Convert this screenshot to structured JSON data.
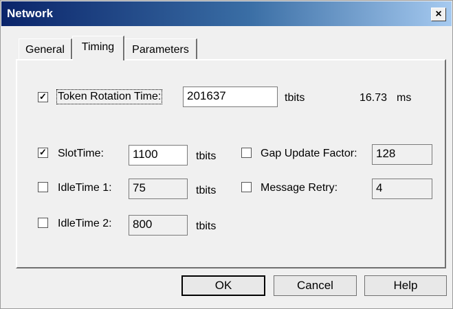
{
  "window": {
    "title": "Network",
    "close_glyph": "×"
  },
  "tabs": [
    {
      "label": "General",
      "active": false
    },
    {
      "label": "Timing",
      "active": true
    },
    {
      "label": "Parameters",
      "active": false
    }
  ],
  "token_rotation": {
    "label": "Token Rotation Time:",
    "checked": true,
    "value": "201637",
    "unit": "tbits",
    "ms_value": "16.73",
    "ms_unit": "ms"
  },
  "slot_time": {
    "label": "SlotTime:",
    "checked": true,
    "value": "1100",
    "unit": "tbits"
  },
  "idle_time_1": {
    "label": "IdleTime 1:",
    "checked": false,
    "value": "75",
    "unit": "tbits"
  },
  "idle_time_2": {
    "label": "IdleTime 2:",
    "checked": false,
    "value": "800",
    "unit": "tbits"
  },
  "gap_update": {
    "label": "Gap Update Factor:",
    "checked": false,
    "value": "128"
  },
  "message_retry": {
    "label": "Message Retry:",
    "checked": false,
    "value": "4"
  },
  "buttons": {
    "ok": "OK",
    "cancel": "Cancel",
    "help": "Help"
  },
  "colors": {
    "title_bar_start": "#0a246a",
    "title_bar_end": "#a6caf0",
    "dialog_bg": "#f0f0f0"
  }
}
